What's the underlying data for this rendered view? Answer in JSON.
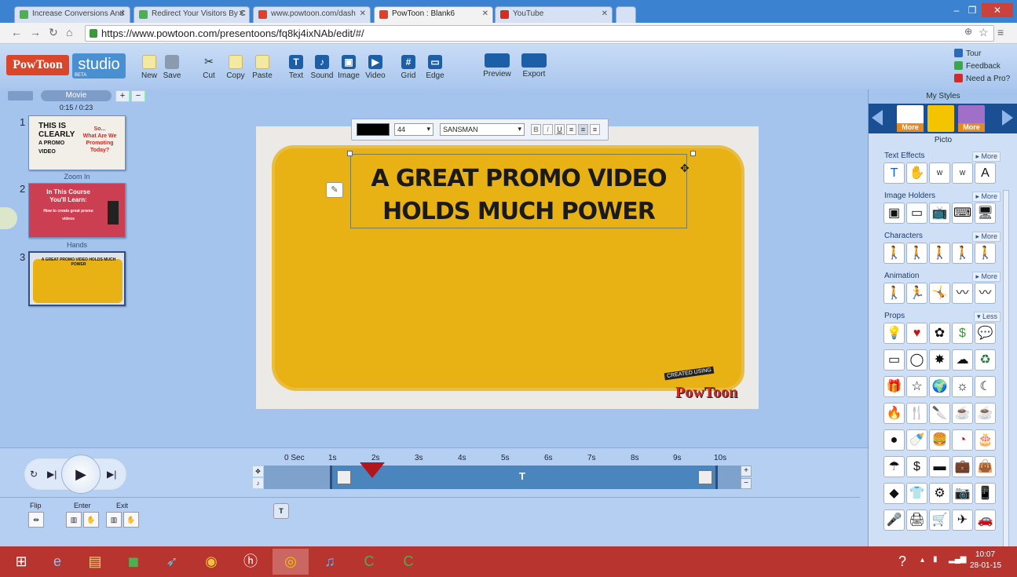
{
  "browser": {
    "tabs": [
      {
        "label": "Increase Conversions And",
        "fav": "#4caf50"
      },
      {
        "label": "Redirect Your Visitors By C",
        "fav": "#4caf50"
      },
      {
        "label": "www.powtoon.com/dash",
        "fav": "#e0402a"
      },
      {
        "label": "PowToon : Blank6",
        "fav": "#e0402a"
      },
      {
        "label": "YouTube",
        "fav": "#d62d20"
      }
    ],
    "url": "https://www.powtoon.com/presentoons/fq8kj4ixNAb/edit/#/"
  },
  "toolbar": {
    "new": "New",
    "save": "Save",
    "cut": "Cut",
    "copy": "Copy",
    "paste": "Paste",
    "text": "Text",
    "sound": "Sound",
    "image": "Image",
    "video": "Video",
    "grid": "Grid",
    "edge": "Edge",
    "preview": "Preview",
    "export": "Export",
    "logo_left": "PowToon",
    "logo_right": "studio",
    "beta": "BETA",
    "tour": "Tour",
    "feedback": "Feedback",
    "need_pro": "Need a Pro?"
  },
  "left": {
    "mode": "Movie",
    "time": "0:15 / 0:23",
    "slides": [
      {
        "num": "1",
        "l1": "THIS IS",
        "l2": "CLEARLY",
        "l3": "A PROMO VIDEO",
        "r1": "So...",
        "r2": "What Are We Promoting Today?"
      },
      {
        "num": "2",
        "t1": "In This Course",
        "t2": "You'll Learn:",
        "t3": "How to create great promo videos"
      },
      {
        "num": "3",
        "t1": "A GREAT PROMO VIDEO HOLDS MUCH POWER"
      }
    ],
    "transitions": [
      "Zoom In",
      "Hands"
    ]
  },
  "stage": {
    "headline": "A GREAT PROMO VIDEO HOLDS MUCH POWER",
    "font_size": "44",
    "font_name": "SANSMAN",
    "fmt_b": "B",
    "fmt_i": "I",
    "fmt_u": "U",
    "created_using": "CREATED USING",
    "created_logo": "PowToon"
  },
  "right": {
    "title": "My Styles",
    "style_name": "Picto",
    "more": "More",
    "less": "Less",
    "sections": {
      "text_effects": "Text Effects",
      "image_holders": "Image Holders",
      "characters": "Characters",
      "animation": "Animation",
      "props": "Props"
    }
  },
  "timeline": {
    "ticks": [
      "0 Sec",
      "1s",
      "2s",
      "3s",
      "4s",
      "5s",
      "6s",
      "7s",
      "8s",
      "9s",
      "10s"
    ],
    "flip": "Flip",
    "enter": "Enter",
    "exit": "Exit"
  },
  "taskbar": {
    "time": "10:07",
    "date": "28-01-15"
  }
}
